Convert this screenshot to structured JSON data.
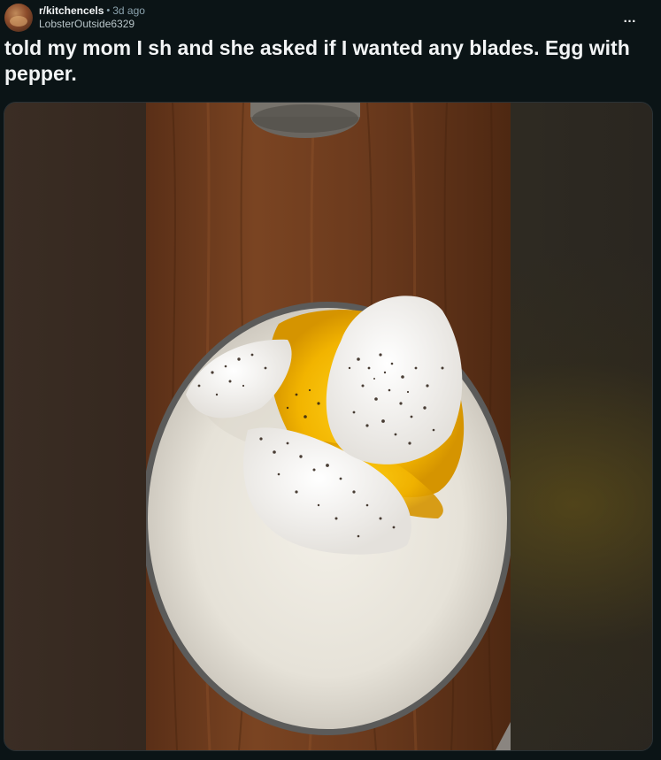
{
  "post": {
    "subreddit": "r/kitchencels",
    "separator": "•",
    "time": "3d ago",
    "author": "LobsterOutside6329",
    "more_icon": "…",
    "title": "told my mom I sh and she asked if I wanted any blades. Egg with pepper."
  },
  "media": {
    "icon": "photo",
    "description_hidden": true
  },
  "colors": {
    "background": "#0b1416",
    "text": "#f2f4f5",
    "muted": "#8ba2ad"
  }
}
